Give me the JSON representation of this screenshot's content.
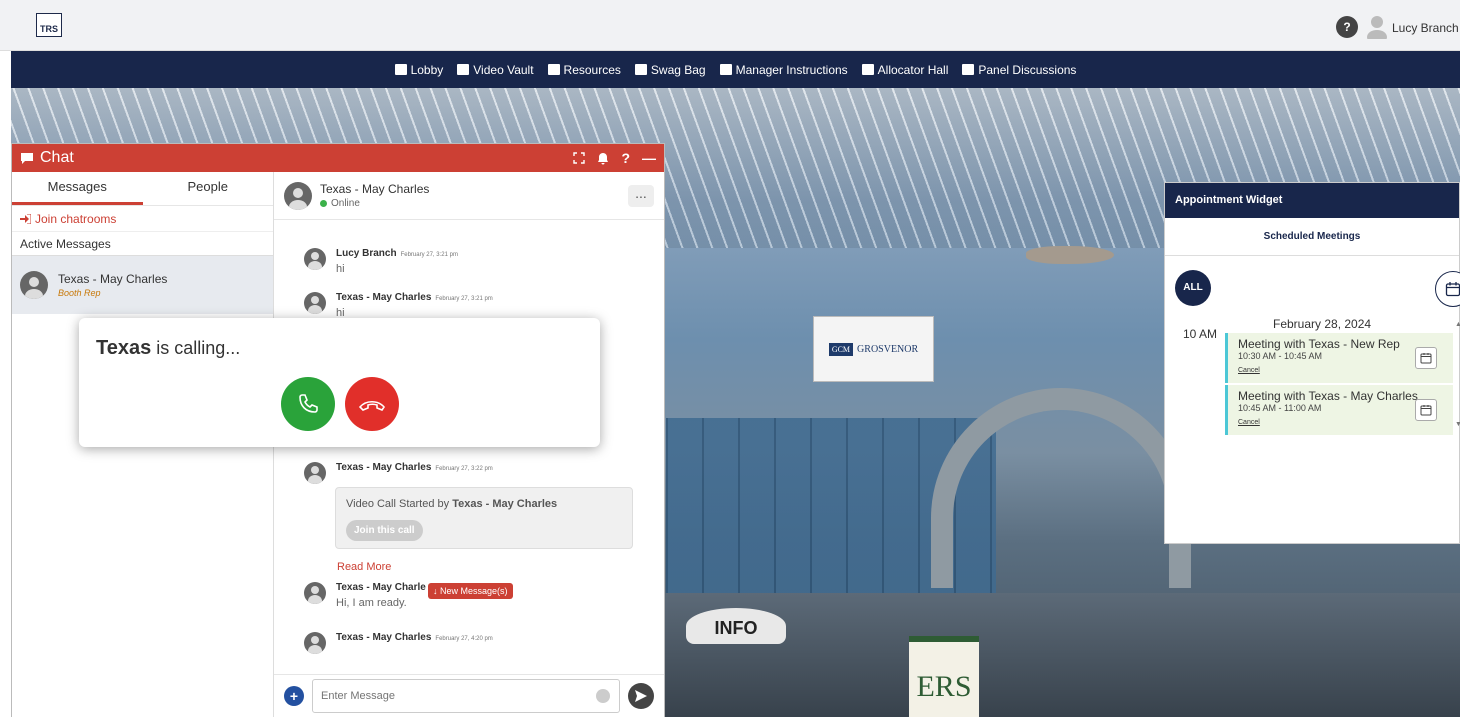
{
  "header": {
    "logo_text": "TRS",
    "help_label": "?",
    "user_name": "Lucy Branch ▾"
  },
  "nav": {
    "items": [
      {
        "label": "Lobby"
      },
      {
        "label": "Video Vault"
      },
      {
        "label": "Resources"
      },
      {
        "label": "Swag Bag"
      },
      {
        "label": "Manager Instructions"
      },
      {
        "label": "Allocator Hall"
      },
      {
        "label": "Panel Discussions"
      }
    ]
  },
  "scene": {
    "gcm_sign": "GCM",
    "grosvenor_sign": "GROSVENOR",
    "info_sign": "INFO",
    "ers_sign": "ERS"
  },
  "chat": {
    "title": "Chat",
    "tabs": [
      "Messages",
      "People"
    ],
    "join_chatrooms": "Join chatrooms",
    "active_messages": "Active Messages",
    "contact": {
      "name": "Texas - May Charles",
      "role": "Booth Rep"
    },
    "conversation": {
      "name": "Texas - May Charles",
      "status": "Online",
      "more": "..."
    },
    "messages": [
      {
        "sender": "Lucy Branch",
        "time": "February 27, 3:21 pm",
        "text": "hi"
      },
      {
        "sender": "Texas - May Charles",
        "time": "February 27, 3:21 pm",
        "text": "hi"
      },
      {
        "sender": "Texas - May Charles",
        "time": "February 27, 3:22 pm",
        "text": ""
      },
      {
        "sender": "Texas - May Charle",
        "time": "",
        "text": "Hi, I am ready."
      },
      {
        "sender": "Texas - May Charles",
        "time": "February 27, 4:20 pm",
        "text": ""
      }
    ],
    "video_call": {
      "prefix": "Video Call Started by ",
      "by": "Texas - May Charles",
      "join_label": "Join this call"
    },
    "read_more": "Read More",
    "new_message": "New Message(s)",
    "input_placeholder": "Enter Message"
  },
  "incoming_call": {
    "caller": "Texas",
    "suffix": " is calling..."
  },
  "appointment": {
    "title": "Appointment Widget",
    "subtitle": "Scheduled Meetings",
    "all_label": "ALL",
    "date": "February 28, 2024",
    "time_label": "10 AM",
    "meetings": [
      {
        "title": "Meeting with Texas - New Rep",
        "time": "10:30 AM - 10:45 AM",
        "cancel": "Cancel"
      },
      {
        "title": "Meeting with Texas - May Charles",
        "time": "10:45 AM - 11:00 AM",
        "cancel": "Cancel"
      }
    ]
  },
  "colors": {
    "navy": "#18264b",
    "chat_red": "#cc4034",
    "accept_green": "#2aa33a",
    "decline_red": "#e12f2a",
    "meeting_bg": "#eef5e4"
  }
}
